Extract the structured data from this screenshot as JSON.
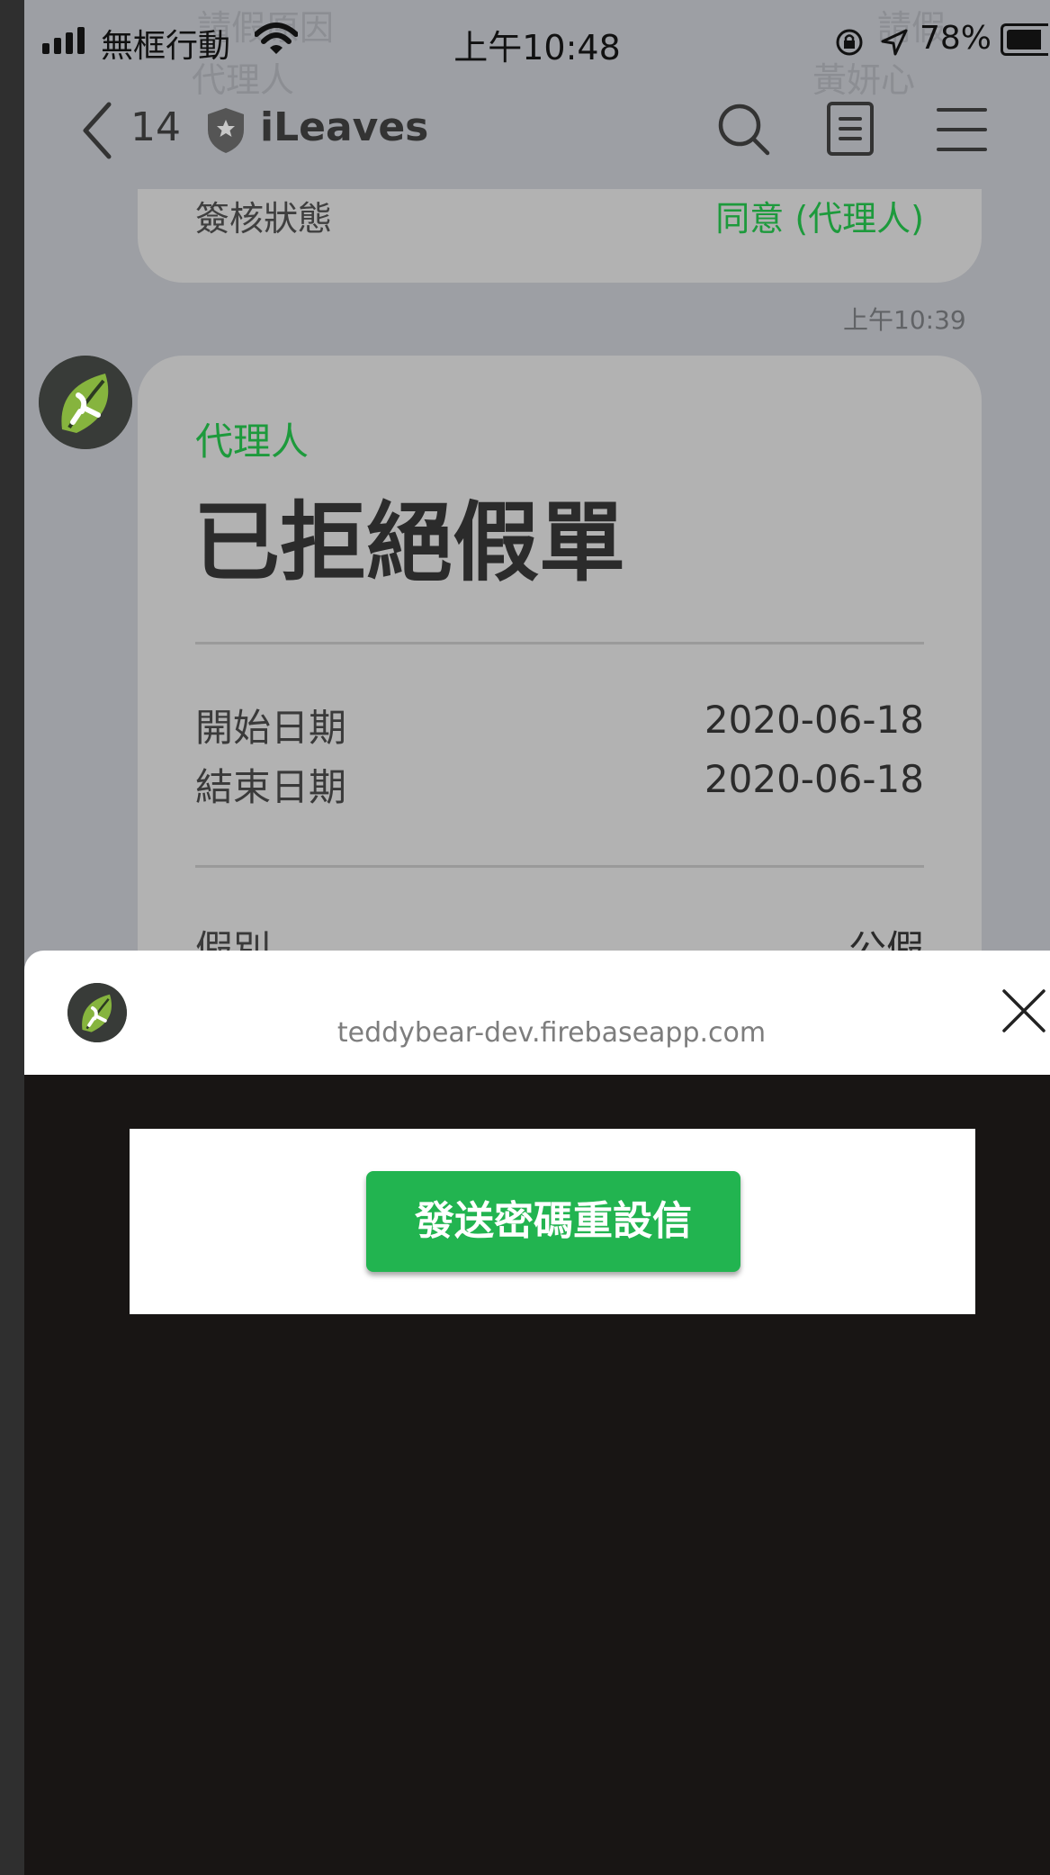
{
  "status": {
    "carrier": "無框行動",
    "time": "上午10:48",
    "battery": "78%"
  },
  "ghost": {
    "left_top": "請假原因",
    "left_bottom": "代理人",
    "right_top": "請假",
    "right_bottom": "黃妍心"
  },
  "nav": {
    "unread_count": "14",
    "app_name": "iLeaves"
  },
  "chat": {
    "prev_card": {
      "label": "簽核狀態",
      "value": "同意 (代理人)"
    },
    "timestamp": "上午10:39",
    "card": {
      "subtitle": "代理人",
      "title": "已拒絕假單",
      "rows": [
        {
          "label": "開始日期",
          "value": "2020-06-18"
        },
        {
          "label": "結束日期",
          "value": "2020-06-18"
        }
      ],
      "type_label": "假別",
      "type_value": "公假"
    }
  },
  "popup": {
    "url": "teddybear-dev.firebaseapp.com",
    "button_label": "發送密碼重設信"
  },
  "colors": {
    "accent_green": "#1d9a3c",
    "button_green": "#22b450"
  }
}
